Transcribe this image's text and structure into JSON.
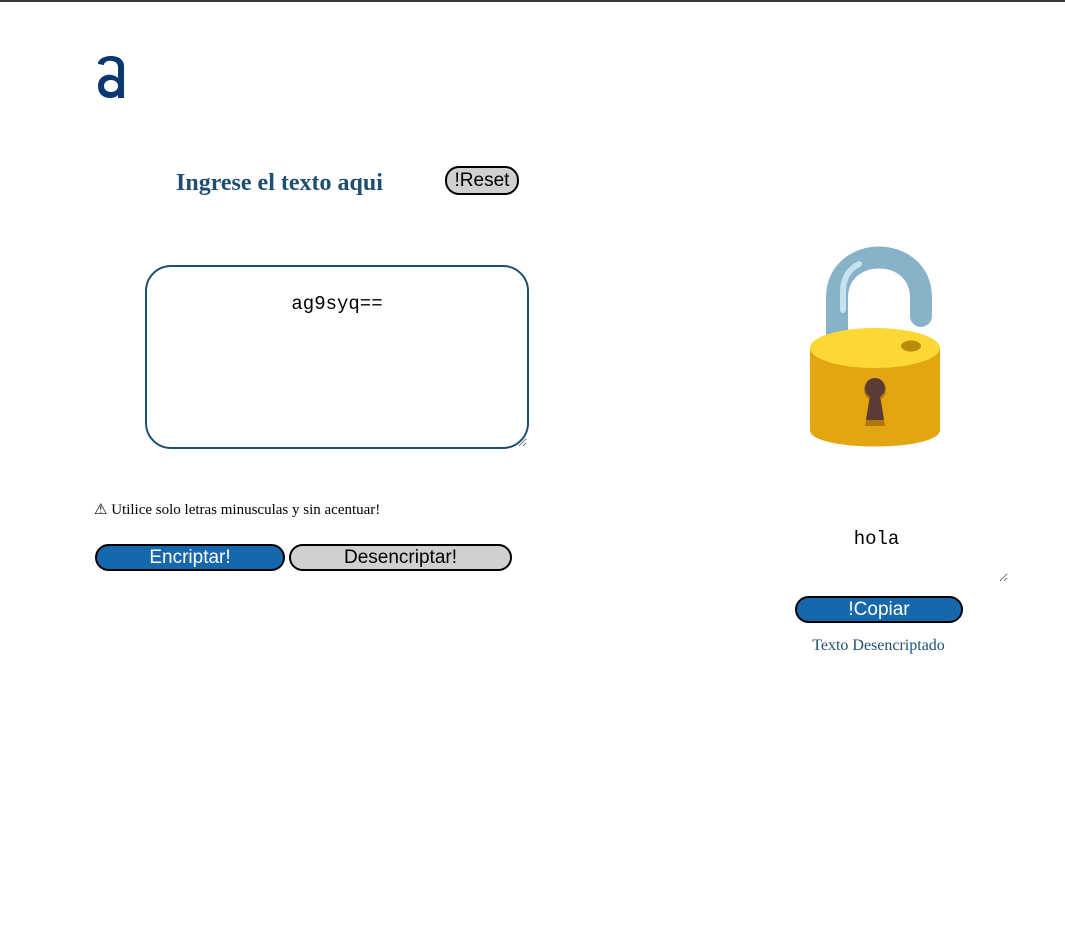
{
  "header": {
    "logo_icon": "alura-a-logo-icon",
    "brand_color": "#0a3871",
    "border_color": "#3b3b3b"
  },
  "input_section": {
    "title": "Ingrese el texto aqui",
    "reset_label": "!Reset",
    "input_value": "ag9syq==",
    "warning_icon": "warning-icon",
    "warning_text": "⚠ Utilice solo letras minusculas y sin acentuar!",
    "encrypt_label": "Encriptar!",
    "decrypt_label": "Desencriptar!",
    "title_color": "#1f4e73",
    "primary_color": "#1667ac",
    "secondary_color": "#d0d0d0"
  },
  "output_section": {
    "lock_icon": "open-padlock-icon",
    "output_value": "hola",
    "copy_label": "!Copiar",
    "status_text": "Texto Desencriptado"
  }
}
